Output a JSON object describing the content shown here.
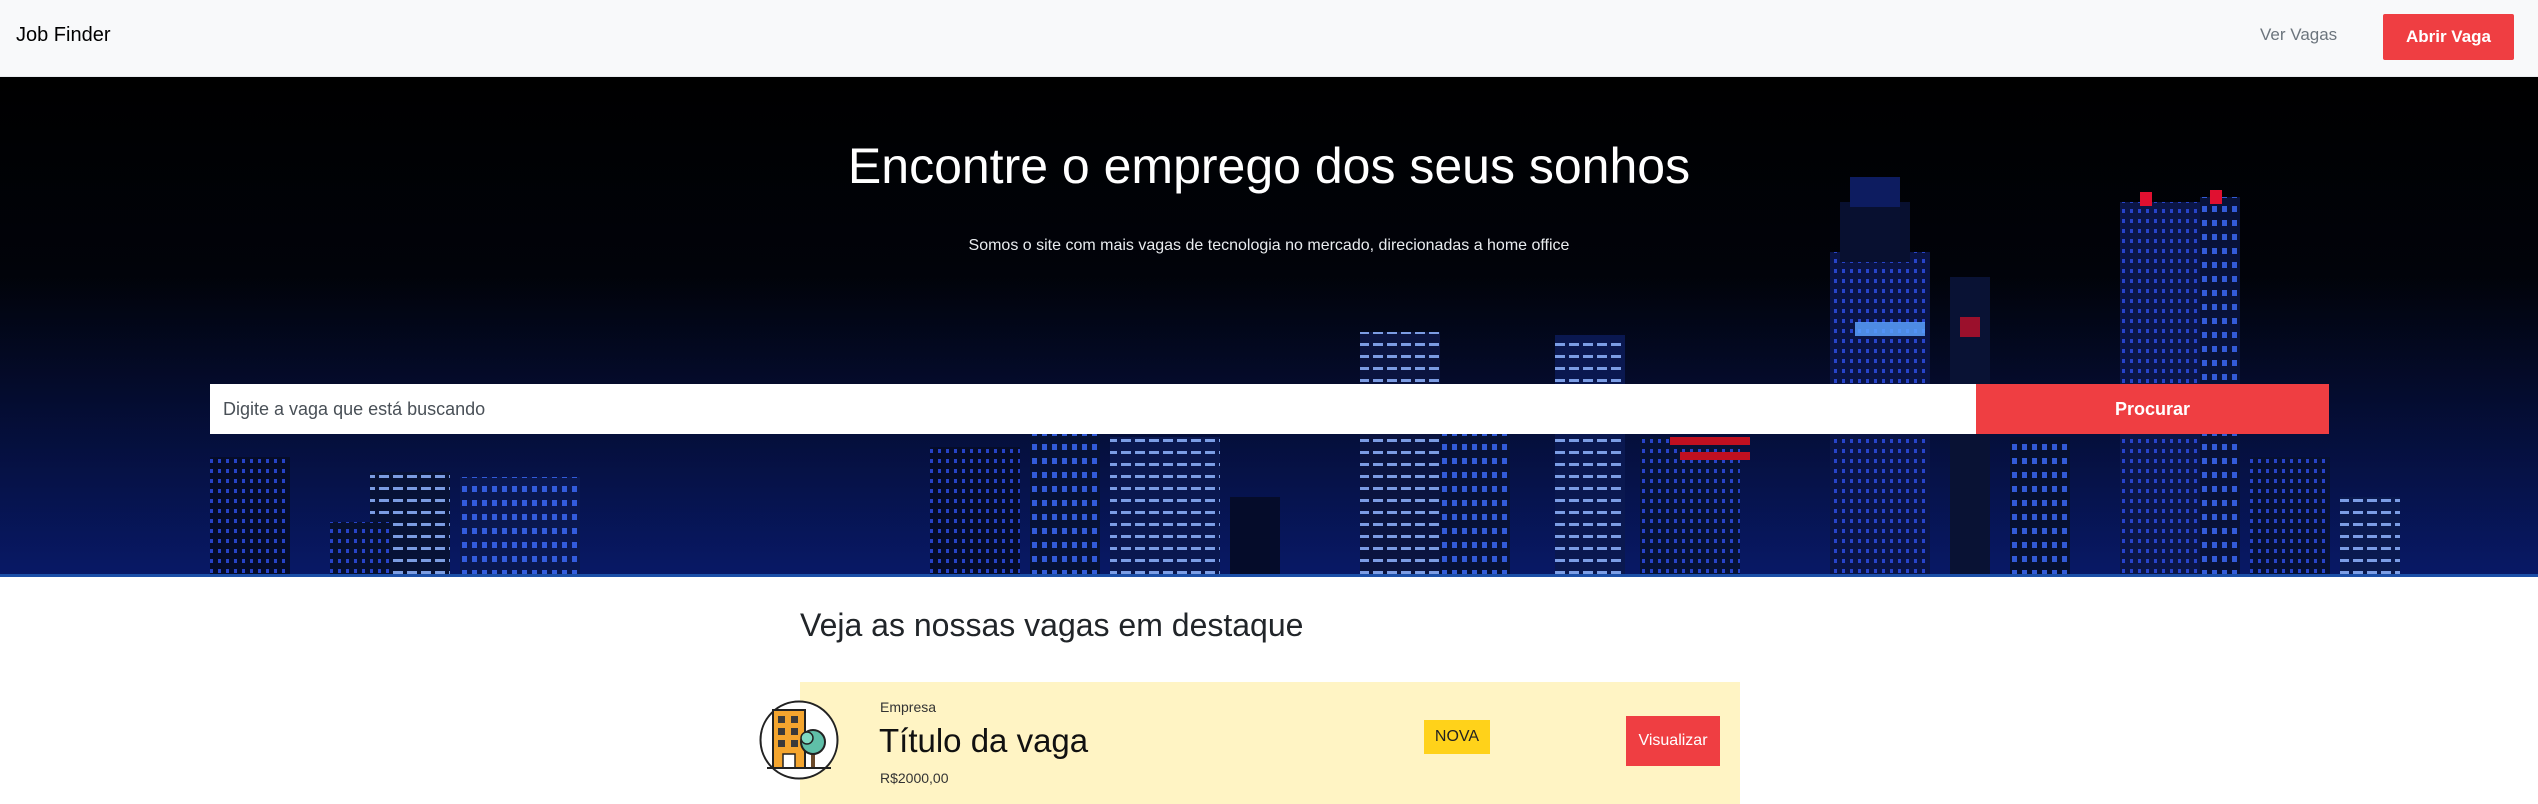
{
  "navbar": {
    "brand": "Job Finder",
    "link_view_jobs": "Ver Vagas",
    "button_open_job": "Abrir Vaga"
  },
  "hero": {
    "title": "Encontre o emprego dos seus sonhos",
    "subtitle": "Somos o site com mais vagas de tecnologia no mercado, direcionadas a home office",
    "search_placeholder": "Digite a vaga que está buscando",
    "search_button": "Procurar"
  },
  "featured": {
    "title": "Veja as nossas vagas em destaque",
    "jobs": [
      {
        "company": "Empresa",
        "title": "Título da vaga",
        "salary": "R$2000,00",
        "badge": "NOVA",
        "button": "Visualizar",
        "logo_icon": "building-tree-icon"
      }
    ]
  },
  "colors": {
    "accent": "#ef3e42",
    "navbar_bg": "#f8f9fa",
    "card_bg": "#fff4c4",
    "badge_bg": "#ffd21a"
  }
}
